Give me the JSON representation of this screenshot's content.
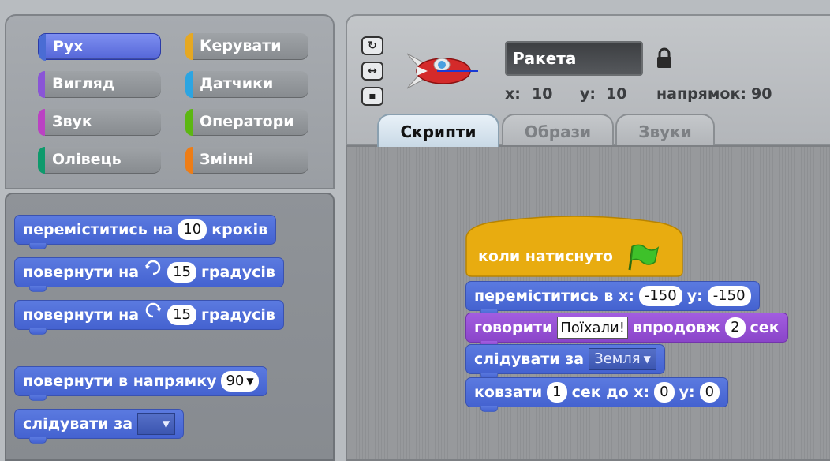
{
  "categories": [
    {
      "label": "Рух",
      "color": "#4a6cd4",
      "active": true
    },
    {
      "label": "Керувати",
      "color": "#e6a822"
    },
    {
      "label": "Вигляд",
      "color": "#8a55d7"
    },
    {
      "label": "Датчики",
      "color": "#2ca5e2"
    },
    {
      "label": "Звук",
      "color": "#bb42c3"
    },
    {
      "label": "Оператори",
      "color": "#5cb712"
    },
    {
      "label": "Олівець",
      "color": "#0e9a6c"
    },
    {
      "label": "Змінні",
      "color": "#ee7d16"
    }
  ],
  "palette": {
    "move": {
      "pre": "переміститись на",
      "value": "10",
      "post": "кроків"
    },
    "turn_cw": {
      "pre": "повернути на",
      "icon": "rotate-cw-icon",
      "value": "15",
      "post": "градусів"
    },
    "turn_ccw": {
      "pre": "повернути на",
      "icon": "rotate-ccw-icon",
      "value": "15",
      "post": "градусів"
    },
    "point": {
      "pre": "повернути в напрямку",
      "value": "90"
    },
    "follow": {
      "pre": "слідувати за",
      "value": ""
    }
  },
  "sprite": {
    "name": "Ракета",
    "x_label": "x:",
    "x": "10",
    "y_label": "y:",
    "y": "10",
    "dir_label": "напрямок:",
    "direction": "90"
  },
  "tabs": [
    {
      "label": "Скрипти",
      "active": true
    },
    {
      "label": "Образи"
    },
    {
      "label": "Звуки"
    }
  ],
  "script": {
    "hat": {
      "label": "коли натиснуто",
      "icon": "green-flag-icon"
    },
    "goto": {
      "pre": "переміститись в x:",
      "x": "-150",
      "mid": "y:",
      "y": "-150"
    },
    "say": {
      "pre": "говорити",
      "text": "Поїхали!",
      "mid": "впродовж",
      "secs": "2",
      "post": "сек"
    },
    "follow": {
      "pre": "слідувати за",
      "target": "Земля"
    },
    "glide": {
      "pre": "ковзати",
      "secs": "1",
      "mid": "сек до x:",
      "x": "0",
      "mid2": "y:",
      "y": "0"
    }
  }
}
